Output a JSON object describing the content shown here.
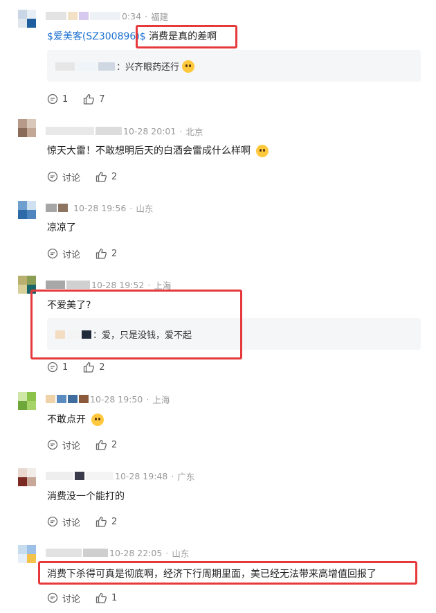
{
  "colors": {
    "highlight": "#e5393b",
    "link": "#1a6fd1",
    "meta": "#9a9a9a",
    "reply_bg": "#f5f6f8"
  },
  "comments": [
    {
      "time": "0:34",
      "location": "福建",
      "stock": "$爱美客(SZ300896)$",
      "text": "消费是真的差啊",
      "reply": {
        "suffix": "：兴齐眼药还行",
        "emoji": "grinning-sweat-emoji"
      },
      "discuss_label": "1",
      "likes": "7"
    },
    {
      "time": "10-28 20:01",
      "location": "北京",
      "text": "惊天大雷！不敢想明后天的白酒会雷成什么样啊",
      "emoji": "shocked-emoji",
      "discuss_label": "讨论",
      "likes": "2"
    },
    {
      "time": "10-28 19:56",
      "location": "山东",
      "text": "凉凉了",
      "discuss_label": "讨论",
      "likes": "2"
    },
    {
      "time": "10-28 19:52",
      "location": "上海",
      "text": "不爱美了?",
      "reply": {
        "suffix": "：爱，只是没钱，爱不起"
      },
      "discuss_label": "1",
      "likes": "2"
    },
    {
      "time": "10-28 19:50",
      "location": "上海",
      "text": "不敢点开",
      "emoji": "laugh-cry-emoji",
      "discuss_label": "讨论",
      "likes": "2"
    },
    {
      "time": "10-28 19:48",
      "location": "广东",
      "text": "消费没一个能打的",
      "discuss_label": "讨论",
      "likes": "2"
    },
    {
      "time": "10-28 22:05",
      "location": "山东",
      "text": "消费下杀得可真是彻底啊，经济下行周期里面，美已经无法带来高增值回报了",
      "discuss_label": "讨论",
      "likes": "1"
    }
  ]
}
